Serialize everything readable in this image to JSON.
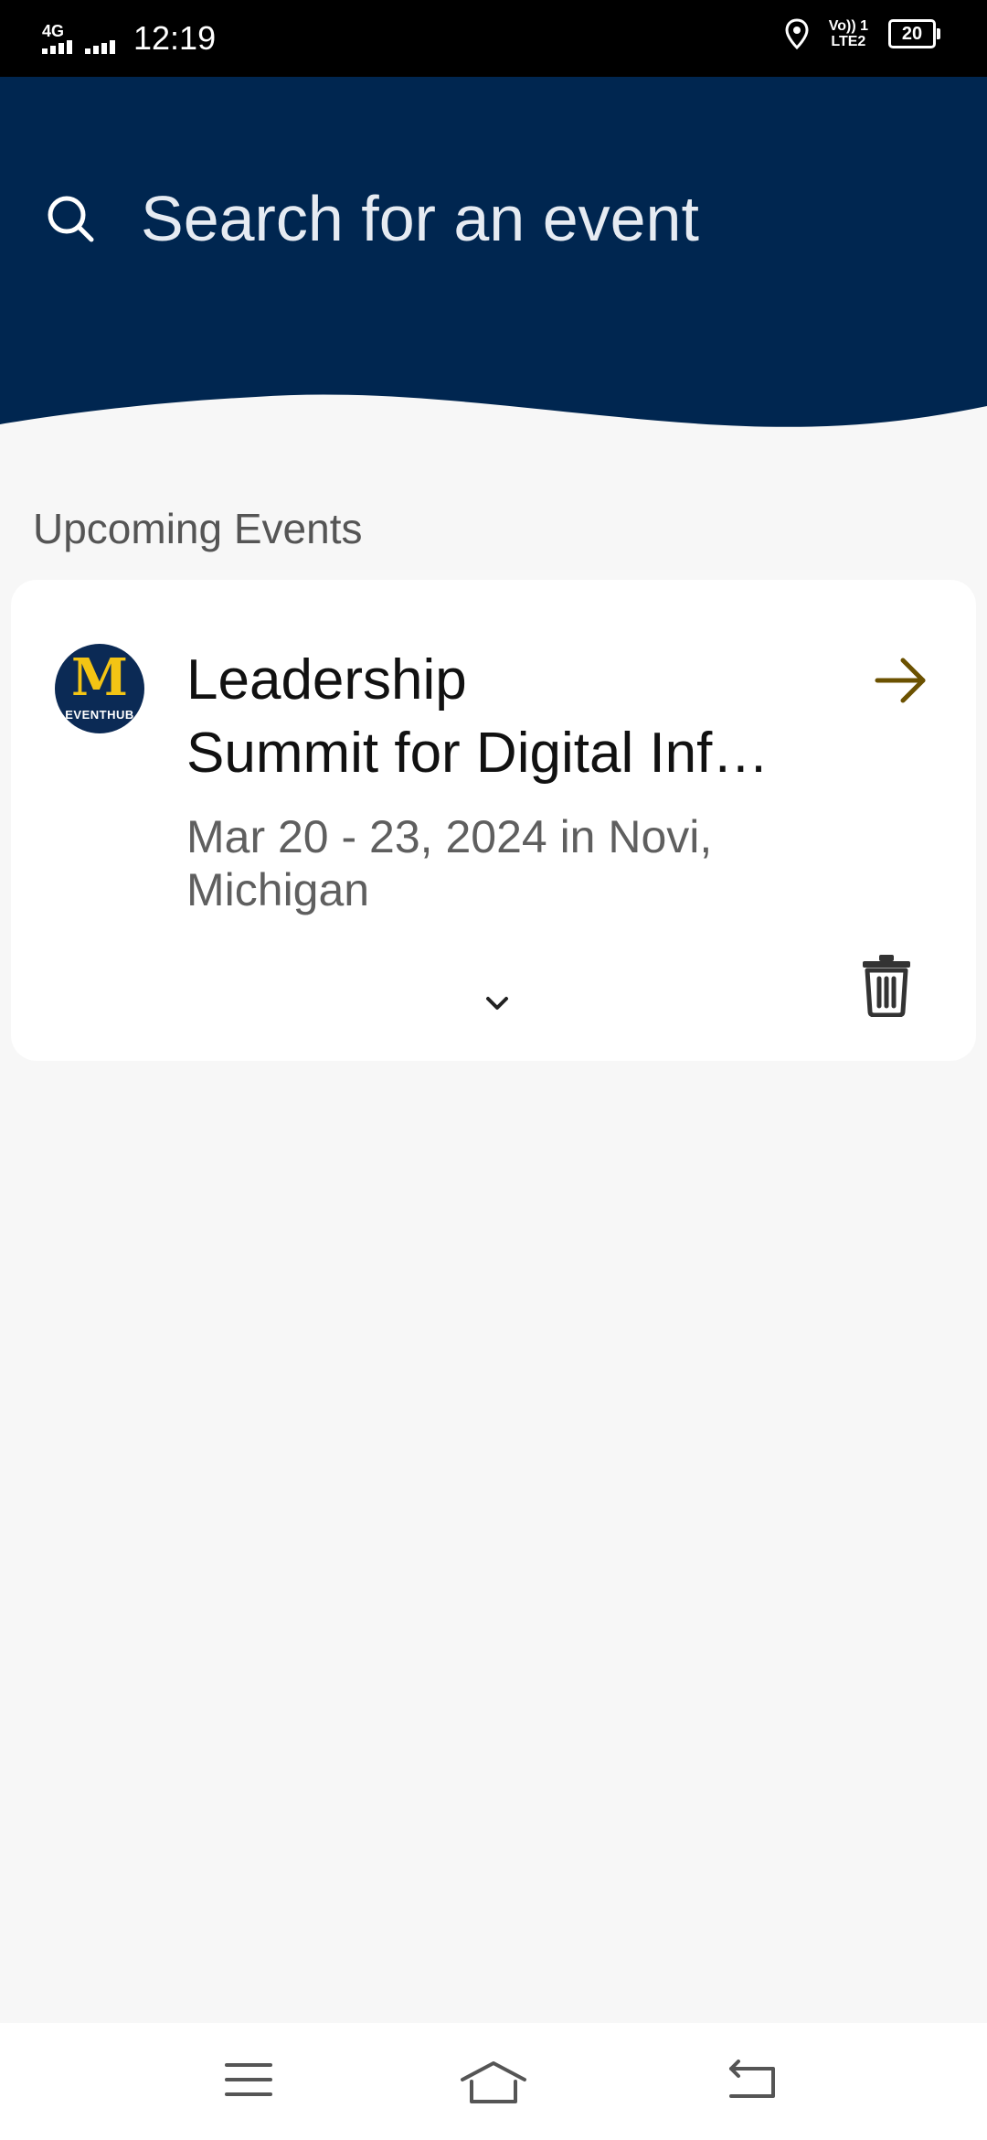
{
  "status_bar": {
    "network_type": "4G",
    "time": "12:19",
    "volte_line1": "Vo)) 1",
    "volte_line2": "LTE2",
    "battery": "20"
  },
  "header": {
    "search_placeholder": "Search for an event",
    "background_color": "#002650"
  },
  "upcoming": {
    "section_title": "Upcoming Events",
    "events": [
      {
        "logo_letter": "M",
        "logo_caption": "EVENTHUB",
        "title_line1": "Leadership",
        "title_line2": "Summit for Digital Inf…",
        "date_location_line1": "Mar 20 - 23, 2024 in Novi,",
        "date_location_line2": "Michigan",
        "arrow_color": "#6b5100",
        "icons": [
          "arrow-right-icon",
          "chevron-down-icon",
          "trash-icon"
        ]
      }
    ]
  },
  "navigation": {
    "icons": [
      "menu-icon",
      "home-icon",
      "back-icon"
    ]
  }
}
